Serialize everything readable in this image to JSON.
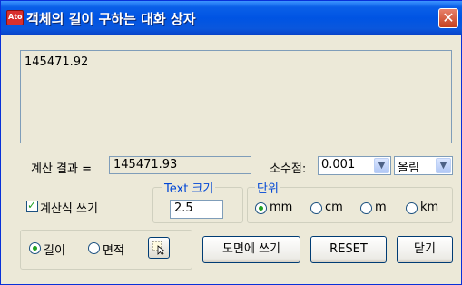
{
  "window": {
    "title": "객체의 길이 구하는 대화 상자",
    "app_icon_text": "Ato",
    "close_glyph": "✕"
  },
  "result_text": "145471.92",
  "calc": {
    "label": "계산 결과 =",
    "value": "145471.93"
  },
  "decimal": {
    "label": "소수점:",
    "precision": "0.001",
    "rounding": "올림"
  },
  "formula": {
    "checkbox_label": "계산식 쓰기",
    "checked": true
  },
  "text_size": {
    "legend": "Text 크기",
    "value": "2.5"
  },
  "units": {
    "legend": "단위",
    "options": [
      "mm",
      "cm",
      "m",
      "km"
    ],
    "selected": "mm"
  },
  "mode": {
    "options": [
      "길이",
      "면적"
    ],
    "selected": "길이"
  },
  "buttons": {
    "write_drawing": "도면에 쓰기",
    "reset": "RESET",
    "close": "닫기"
  },
  "colors": {
    "titlebar": "#0054e3",
    "accent_legend": "#0046d5",
    "check_green": "#21a121"
  }
}
